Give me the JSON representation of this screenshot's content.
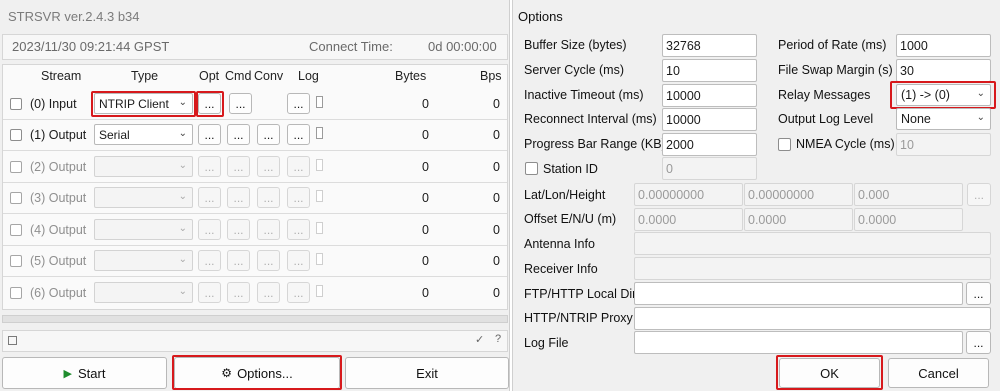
{
  "main_window": {
    "title": "STRSVR ver.2.4.3 b34",
    "status": {
      "timestamp": "2023/11/30 09:21:44 GPST",
      "connect_label": "Connect Time:",
      "connect_value": "0d 00:00:00"
    },
    "columns": {
      "stream": "Stream",
      "type": "Type",
      "opt": "Opt",
      "cmd": "Cmd",
      "conv": "Conv",
      "log": "Log",
      "bytes": "Bytes",
      "bps": "Bps"
    },
    "rows": [
      {
        "name": "(0) Input",
        "type": "NTRIP Client",
        "bytes": "0",
        "bps": "0"
      },
      {
        "name": "(1) Output",
        "type": "Serial",
        "bytes": "0",
        "bps": "0"
      },
      {
        "name": "(2) Output",
        "type": "",
        "bytes": "0",
        "bps": "0"
      },
      {
        "name": "(3) Output",
        "type": "",
        "bytes": "0",
        "bps": "0"
      },
      {
        "name": "(4) Output",
        "type": "",
        "bytes": "0",
        "bps": "0"
      },
      {
        "name": "(5) Output",
        "type": "",
        "bytes": "0",
        "bps": "0"
      },
      {
        "name": "(6) Output",
        "type": "",
        "bytes": "0",
        "bps": "0"
      }
    ],
    "ellipsis": "...",
    "small_check": "✓",
    "small_question": "?",
    "buttons": {
      "start": "Start",
      "options": "Options...",
      "exit": "Exit"
    },
    "icons": {
      "start": "play-icon",
      "options": "gear-icon"
    }
  },
  "options_dialog": {
    "title": "Options",
    "fields": {
      "buffer_size": {
        "label": "Buffer Size (bytes)",
        "value": "32768"
      },
      "server_cycle": {
        "label": "Server Cycle  (ms)",
        "value": "10"
      },
      "inactive_timeout": {
        "label": "Inactive Timeout (ms)",
        "value": "10000"
      },
      "reconnect_interval": {
        "label": "Reconnect Interval  (ms)",
        "value": "10000"
      },
      "progress_bar_range": {
        "label": "Progress Bar Range (KB)",
        "value": "2000"
      },
      "station_id": {
        "label": "Station ID",
        "value": "0"
      },
      "period_of_rate": {
        "label": "Period of Rate (ms)",
        "value": "1000"
      },
      "file_swap_margin": {
        "label": "File Swap Margin (s)",
        "value": "30"
      },
      "relay_messages": {
        "label": "Relay Messages",
        "value": "(1)  -> (0)"
      },
      "output_log_level": {
        "label": "Output Log Level",
        "value": "None"
      },
      "nmea_cycle": {
        "label": "NMEA Cycle (ms)",
        "value": "10"
      },
      "lat_lon_height": {
        "label": "Lat/Lon/Height",
        "values": [
          "0.00000000",
          "0.00000000",
          "0.000"
        ]
      },
      "offset_enu": {
        "label": "Offset E/N/U (m)",
        "values": [
          "0.0000",
          "0.0000",
          "0.0000"
        ]
      },
      "antenna_info": {
        "label": "Antenna Info",
        "value": ""
      },
      "receiver_info": {
        "label": "Receiver Info",
        "value": ""
      },
      "ftp_http_local_dir": {
        "label": "FTP/HTTP Local Dir",
        "value": ""
      },
      "http_ntrip_proxy": {
        "label": "HTTP/NTRIP Proxy",
        "value": ""
      },
      "log_file": {
        "label": "Log File",
        "value": ""
      }
    },
    "ellipsis": "...",
    "buttons": {
      "ok": "OK",
      "cancel": "Cancel"
    }
  },
  "highlight_color": "#d7191c"
}
